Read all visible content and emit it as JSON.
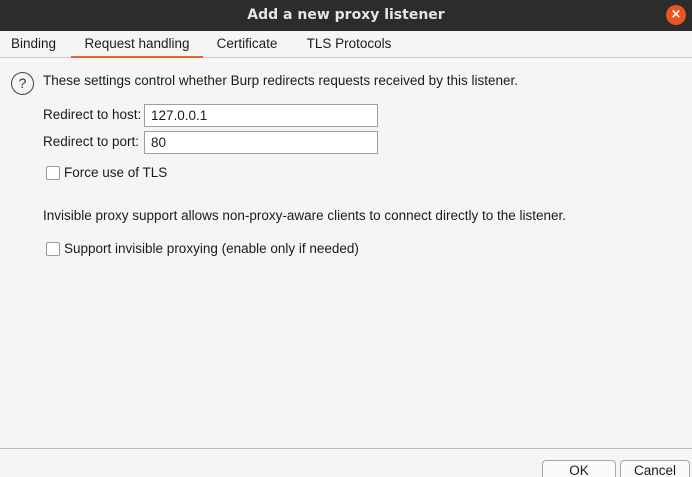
{
  "window": {
    "title": "Add a new proxy listener",
    "close_icon": "×"
  },
  "tabs": [
    {
      "label": "Binding",
      "active": false
    },
    {
      "label": "Request handling",
      "active": true
    },
    {
      "label": "Certificate",
      "active": false
    },
    {
      "label": "TLS Protocols",
      "active": false
    }
  ],
  "request_handling": {
    "help_icon": "?",
    "description": "These settings control whether Burp redirects requests received by this listener.",
    "redirect_host_label": "Redirect to host:",
    "redirect_host_value": "127.0.0.1",
    "redirect_port_label": "Redirect to port:",
    "redirect_port_value": "80",
    "force_tls_label": "Force use of TLS",
    "force_tls_checked": false,
    "invisible_note": "Invisible proxy support allows non-proxy-aware clients to connect directly to the listener.",
    "invisible_label": "Support invisible proxying (enable only if needed)",
    "invisible_checked": false
  },
  "footer": {
    "ok_label": "OK",
    "cancel_label": "Cancel"
  },
  "colors": {
    "titlebar": "#2c2c2c",
    "close_button": "#e95420",
    "active_tab_underline": "#e8622c"
  }
}
